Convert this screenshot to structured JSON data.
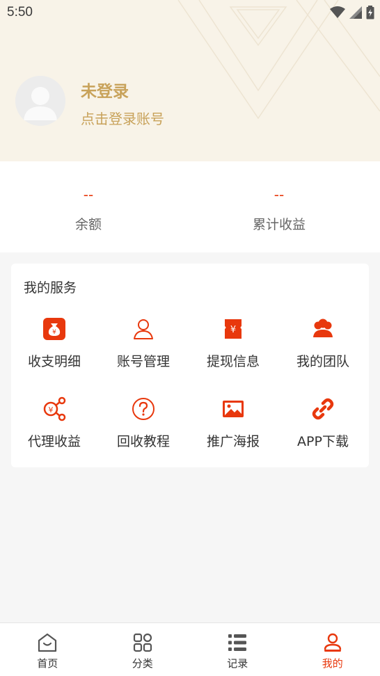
{
  "status_bar": {
    "time": "5:50"
  },
  "profile": {
    "name": "未登录",
    "subtitle": "点击登录账号"
  },
  "stats": [
    {
      "value": "--",
      "label": "余额"
    },
    {
      "value": "--",
      "label": "累计收益"
    }
  ],
  "services": {
    "title": "我的服务",
    "items": [
      {
        "label": "收支明细",
        "icon": "money-bag-icon"
      },
      {
        "label": "账号管理",
        "icon": "user-outline-icon"
      },
      {
        "label": "提现信息",
        "icon": "yuan-ticket-icon"
      },
      {
        "label": "我的团队",
        "icon": "team-icon"
      },
      {
        "label": "代理收益",
        "icon": "share-yuan-icon"
      },
      {
        "label": "回收教程",
        "icon": "question-circle-icon"
      },
      {
        "label": "推广海报",
        "icon": "image-icon"
      },
      {
        "label": "APP下载",
        "icon": "link-icon"
      }
    ]
  },
  "tabbar": {
    "items": [
      {
        "label": "首页",
        "icon": "home-icon"
      },
      {
        "label": "分类",
        "icon": "grid-icon"
      },
      {
        "label": "记录",
        "icon": "list-icon"
      },
      {
        "label": "我的",
        "icon": "profile-icon"
      }
    ],
    "active": "我的"
  },
  "colors": {
    "accent": "#e8380d",
    "gold": "#c8a25a",
    "header_bg": "#f8f3e8"
  }
}
